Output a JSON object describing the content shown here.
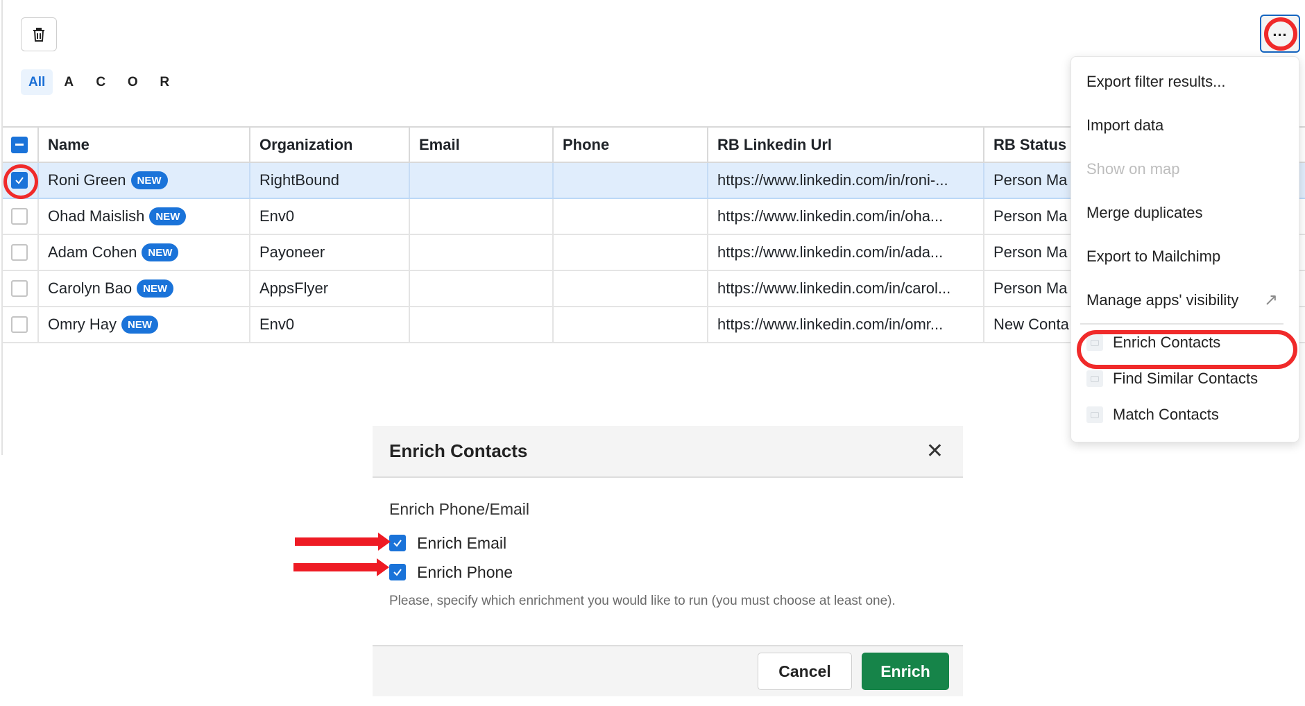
{
  "toolbar": {
    "delete_icon": "trash-icon",
    "more_icon": "ellipsis-icon",
    "more_label": "..."
  },
  "letter_filter": [
    {
      "label": "All",
      "active": true
    },
    {
      "label": "A",
      "active": false
    },
    {
      "label": "C",
      "active": false
    },
    {
      "label": "O",
      "active": false
    },
    {
      "label": "R",
      "active": false
    }
  ],
  "table": {
    "columns": [
      "Name",
      "Organization",
      "Email",
      "Phone",
      "RB Linkedin Url",
      "RB Status"
    ],
    "header_checkbox": "partial",
    "badge_label": "NEW",
    "rows": [
      {
        "name": "Roni Green",
        "badge": "NEW",
        "organization": "RightBound",
        "email": "",
        "phone": "",
        "linkedin": "https://www.linkedin.com/in/roni-...",
        "status": "Person Ma",
        "selected": true
      },
      {
        "name": "Ohad Maislish",
        "badge": "NEW",
        "organization": "Env0",
        "email": "",
        "phone": "",
        "linkedin": "https://www.linkedin.com/in/oha...",
        "status": "Person Ma",
        "selected": false
      },
      {
        "name": "Adam Cohen",
        "badge": "NEW",
        "organization": "Payoneer",
        "email": "",
        "phone": "",
        "linkedin": "https://www.linkedin.com/in/ada...",
        "status": "Person Ma",
        "selected": false
      },
      {
        "name": "Carolyn Bao",
        "badge": "NEW",
        "organization": "AppsFlyer",
        "email": "",
        "phone": "",
        "linkedin": "https://www.linkedin.com/in/carol...",
        "status": "Person Ma",
        "selected": false
      },
      {
        "name": "Omry Hay",
        "badge": "NEW",
        "organization": "Env0",
        "email": "",
        "phone": "",
        "linkedin": "https://www.linkedin.com/in/omr...",
        "status": "New Conta",
        "selected": false
      }
    ]
  },
  "menu": {
    "items": [
      {
        "label": "Export filter results...",
        "disabled": false
      },
      {
        "label": "Import data",
        "disabled": false
      },
      {
        "label": "Show on map",
        "disabled": true
      },
      {
        "label": "Merge duplicates",
        "disabled": false
      },
      {
        "label": "Export to Mailchimp",
        "disabled": false
      },
      {
        "label": "Manage apps' visibility",
        "disabled": false,
        "icon": "external-arrow-icon",
        "icon_glyph": "↗"
      }
    ],
    "apps": [
      {
        "label": "Enrich Contacts",
        "highlighted": true
      },
      {
        "label": "Find Similar Contacts",
        "highlighted": false
      },
      {
        "label": "Match Contacts",
        "highlighted": false
      }
    ]
  },
  "modal": {
    "title": "Enrich Contacts",
    "close_glyph": "✕",
    "section_label": "Enrich Phone/Email",
    "options": [
      {
        "label": "Enrich Email",
        "checked": true
      },
      {
        "label": "Enrich Phone",
        "checked": true
      }
    ],
    "hint": "Please, specify which enrichment you would like to run (you must choose at least one).",
    "cancel_label": "Cancel",
    "submit_label": "Enrich"
  },
  "colors": {
    "accent_blue": "#1a73d9",
    "selected_row": "#e0edfc",
    "enrich_green": "#168449",
    "annotation_red": "#f02a2a"
  }
}
